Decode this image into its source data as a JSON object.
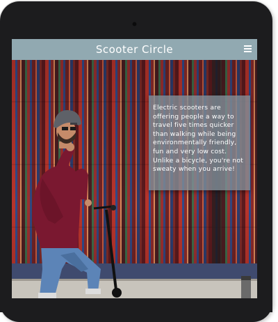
{
  "header": {
    "title": "Scooter Circle",
    "menu_icon": "hamburger-menu-icon"
  },
  "hero": {
    "caption": "Electric scooters are offering people a way to travel five times quicker than walking while being environmentally friendly, fun and very low cost. Unlike a bicycle, you're not sweaty when you arrive!"
  },
  "colors": {
    "nav_bar": "#91a9b1",
    "caption_bg": "#808c96",
    "device_frame": "#1c1c1e"
  }
}
